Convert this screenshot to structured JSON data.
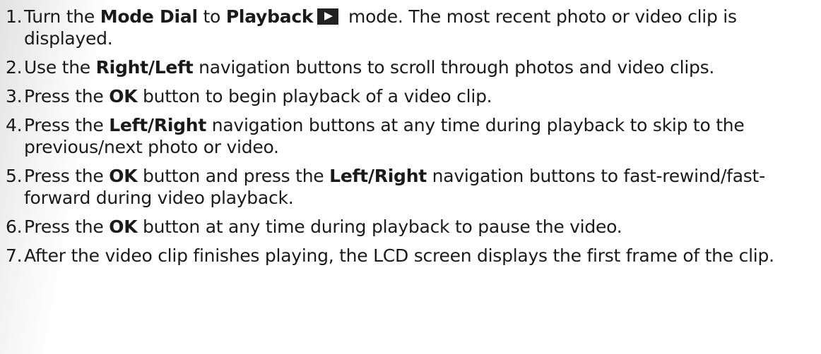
{
  "steps": [
    {
      "num": "1.",
      "parts": [
        {
          "t": "Turn the "
        },
        {
          "t": "Mode Dial",
          "b": true
        },
        {
          "t": " to "
        },
        {
          "t": "Playback",
          "b": true
        },
        {
          "icon": "playback-icon"
        },
        {
          "t": " mode. The most recent photo or video clip is displayed."
        }
      ]
    },
    {
      "num": "2.",
      "parts": [
        {
          "t": "Use the "
        },
        {
          "t": "Right/Left",
          "b": true
        },
        {
          "t": " navigation buttons to scroll through photos and video clips."
        }
      ]
    },
    {
      "num": "3.",
      "parts": [
        {
          "t": "Press the "
        },
        {
          "t": "OK",
          "b": true
        },
        {
          "t": " button to begin playback of a video clip."
        }
      ]
    },
    {
      "num": "4.",
      "parts": [
        {
          "t": "Press the "
        },
        {
          "t": "Left/Right",
          "b": true
        },
        {
          "t": " navigation buttons at any time during playback to skip to the previous/next photo or video."
        }
      ]
    },
    {
      "num": "5.",
      "parts": [
        {
          "t": "Press the "
        },
        {
          "t": "OK",
          "b": true
        },
        {
          "t": " button and press the "
        },
        {
          "t": "Left/Right",
          "b": true
        },
        {
          "t": " navigation buttons to fast-rewind/fast-forward during video playback."
        }
      ]
    },
    {
      "num": "6.",
      "parts": [
        {
          "t": "Press the "
        },
        {
          "t": "OK",
          "b": true
        },
        {
          "t": " button at any time during playback to pause the video."
        }
      ]
    },
    {
      "num": "7.",
      "parts": [
        {
          "t": "After the video clip finishes playing, the LCD screen displays the first frame of the clip."
        }
      ]
    }
  ]
}
